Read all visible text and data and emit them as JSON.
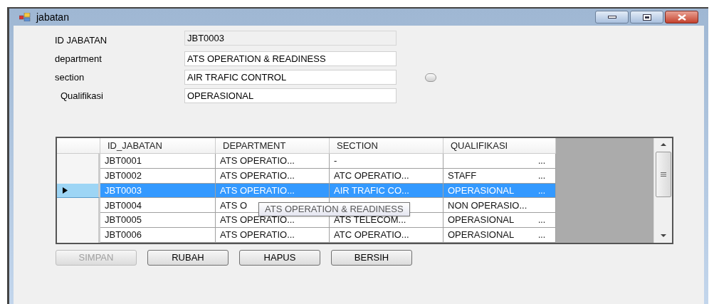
{
  "window": {
    "title": "jabatan"
  },
  "form": [
    {
      "label": "ID JABATAN",
      "value": "JBT0003",
      "disabled": true
    },
    {
      "label": "department",
      "value": "ATS OPERATION & READINESS",
      "disabled": false
    },
    {
      "label": "section",
      "value": "AIR TRAFIC CONTROL",
      "disabled": false
    },
    {
      "label": "Qualifikasi",
      "value": "OPERASIONAL",
      "disabled": false
    }
  ],
  "radio": {
    "checked": false
  },
  "table": {
    "columns": [
      "ID_JABATAN",
      "DEPARTMENT",
      "SECTION",
      "QUALIFIKASI"
    ],
    "rows": [
      {
        "selected": false,
        "cells": [
          {
            "text": "JBT0001"
          },
          {
            "text": "ATS OPERATIO..."
          },
          {
            "text": "-"
          },
          {
            "more": "..."
          }
        ]
      },
      {
        "selected": false,
        "cells": [
          {
            "text": "JBT0002"
          },
          {
            "text": "ATS OPERATIO..."
          },
          {
            "text": "ATC OPERATIO..."
          },
          {
            "text": "STAFF",
            "more": "..."
          }
        ]
      },
      {
        "selected": true,
        "cells": [
          {
            "text": "JBT0003"
          },
          {
            "text": "ATS OPERATIO..."
          },
          {
            "text": "AIR TRAFIC CO..."
          },
          {
            "text": "OPERASIONAL",
            "more": "..."
          }
        ]
      },
      {
        "selected": false,
        "cells": [
          {
            "text": "JBT0004"
          },
          {
            "text": "ATS O"
          },
          {},
          {
            "text": "NON OPERASIO..."
          }
        ]
      },
      {
        "selected": false,
        "cells": [
          {
            "text": "JBT0005"
          },
          {
            "text": "ATS OPERATIO..."
          },
          {
            "text": "ATS TELECOM..."
          },
          {
            "text": "OPERASIONAL",
            "more": "..."
          }
        ]
      },
      {
        "selected": false,
        "cells": [
          {
            "text": "JBT0006"
          },
          {
            "text": "ATS OPERATIO..."
          },
          {
            "text": "ATC OPERATIO..."
          },
          {
            "text": "OPERASIONAL",
            "more": "..."
          }
        ]
      }
    ],
    "tooltip": "ATS OPERATION & READINESS"
  },
  "buttons": [
    {
      "label": "SIMPAN",
      "disabled": true
    },
    {
      "label": "RUBAH",
      "disabled": false
    },
    {
      "label": "HAPUS",
      "disabled": false
    },
    {
      "label": "BERSIH",
      "disabled": false
    }
  ]
}
